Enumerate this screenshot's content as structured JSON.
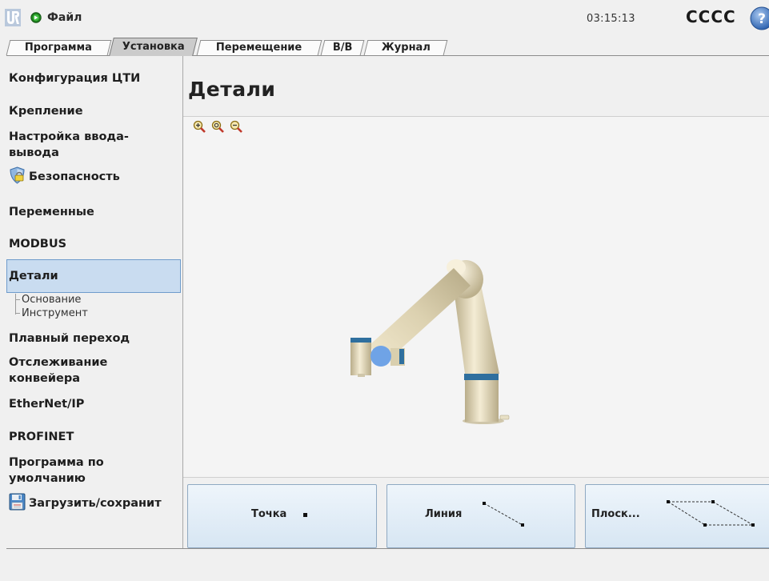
{
  "topbar": {
    "file_menu": "Файл",
    "clock": "03:15:13",
    "robot_name": "CCCC",
    "help": "?"
  },
  "tabs": [
    {
      "label": "Программа"
    },
    {
      "label": "Установка"
    },
    {
      "label": "Перемещение"
    },
    {
      "label": "В/В"
    },
    {
      "label": "Журнал"
    }
  ],
  "sidebar": {
    "items": [
      {
        "label": "Конфигурация ЦТИ"
      },
      {
        "label": "Крепление"
      },
      {
        "label": "Настройка ввода-"
      },
      {
        "label": "вывода"
      },
      {
        "label": "Безопасность"
      },
      {
        "label": "Переменные"
      },
      {
        "label": "MODBUS"
      },
      {
        "label": "Детали"
      },
      {
        "label": "Плавный переход"
      },
      {
        "label": "Отслеживание"
      },
      {
        "label": "конвейера"
      },
      {
        "label": "EtherNet/IP"
      },
      {
        "label": "PROFINET"
      },
      {
        "label": "Программа по"
      },
      {
        "label": "умолчанию"
      },
      {
        "label": "Загрузить/сохранит"
      }
    ],
    "sub_items": [
      {
        "label": "Основание"
      },
      {
        "label": "Инструмент"
      }
    ]
  },
  "main": {
    "title": "Детали"
  },
  "feature_buttons": [
    {
      "label": "Точка"
    },
    {
      "label": "Линия"
    },
    {
      "label": "Плоск..."
    }
  ],
  "colors": {
    "selection_fill": "#c9dcf0",
    "selection_border": "#6f9ccc",
    "button_top": "#eef5fb",
    "button_bottom": "#d7e6f3",
    "robot_body": "#ddd3b4",
    "robot_band": "#2f6f9e",
    "tcp_marker": "#6fa3e6",
    "status_green": "#2e9b2e"
  },
  "icons": {
    "logo": "ur-logo-icon",
    "status": "status-green-icon",
    "help": "help-icon",
    "safety": "shield-icon",
    "save": "save-icon",
    "zoom_in": "zoom-in-icon",
    "zoom_reset": "zoom-reset-icon",
    "zoom_out": "zoom-out-icon"
  }
}
